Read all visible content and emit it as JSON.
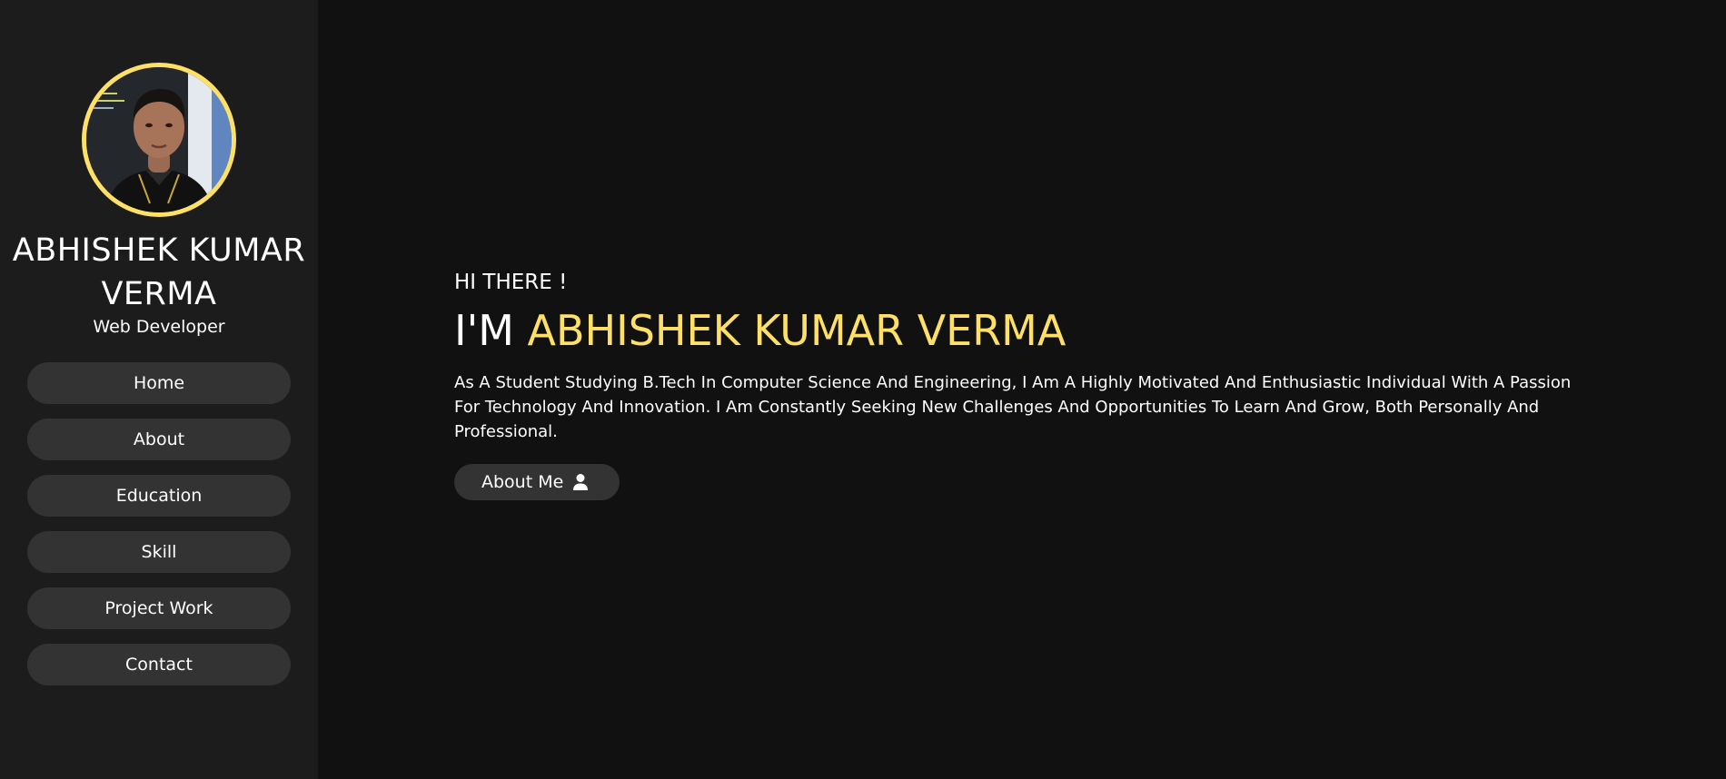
{
  "sidebar": {
    "name": "ABHISHEK KUMAR VERMA",
    "role": "Web Developer",
    "nav": [
      "Home",
      "About",
      "Education",
      "Skill",
      "Project Work",
      "Contact"
    ]
  },
  "hero": {
    "greeting": "HI THERE !",
    "headline_prefix": "I'M",
    "headline_name": "ABHISHEK KUMAR VERMA",
    "bio": "As A Student Studying B.Tech In Computer Science And Engineering, I Am A Highly Motivated And Enthusiastic Individual With A Passion For Technology And Innovation. I Am Constantly Seeking New Challenges And Opportunities To Learn And Grow, Both Personally And Professional.",
    "button_label": "About Me",
    "button_icon": "user-icon"
  },
  "colors": {
    "accent": "#ffe066",
    "background": "#111111",
    "sidebar": "#1c1c1c",
    "pill": "#333333"
  }
}
